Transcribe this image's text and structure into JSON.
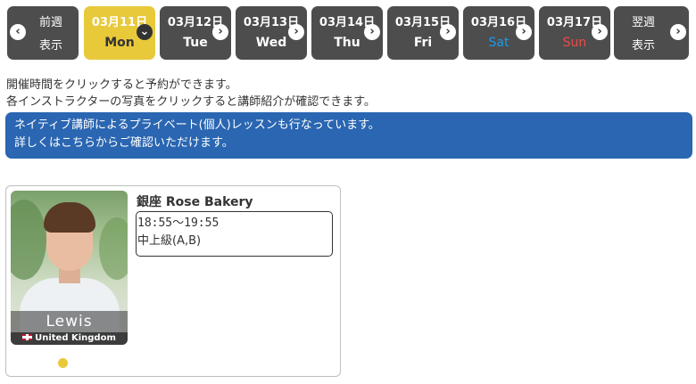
{
  "nav": {
    "prev": {
      "line1": "前週",
      "line2": "表示"
    },
    "next": {
      "line1": "翌週",
      "line2": "表示"
    },
    "days": [
      {
        "date": "03月11日",
        "weekday": "Mon"
      },
      {
        "date": "03月12日",
        "weekday": "Tue"
      },
      {
        "date": "03月13日",
        "weekday": "Wed"
      },
      {
        "date": "03月14日",
        "weekday": "Thu"
      },
      {
        "date": "03月15日",
        "weekday": "Fri"
      },
      {
        "date": "03月16日",
        "weekday": "Sat"
      },
      {
        "date": "03月17日",
        "weekday": "Sun"
      }
    ],
    "active_index": 0,
    "active_color": "#e8c93a",
    "sat_color": "#1e9be6",
    "sun_color": "#ee4a4a"
  },
  "info": {
    "line1": "開催時間をクリックすると予約ができます。",
    "line2": "各インストラクターの写真をクリックすると講師紹介が確認できます。"
  },
  "banner": {
    "line1": "ネイティブ講師によるプライベート(個人)レッスンも行なっています。",
    "line2": "詳しくはこちらからご確認いただけます。",
    "color": "#2a66b1"
  },
  "card": {
    "instructor_name": "Lewis",
    "country": "United Kingdom",
    "location": "銀座 Rose Bakery",
    "lesson": {
      "time": "18:55〜19:55",
      "level": "中上級(A,B)"
    },
    "dot_color": "#e8c93a"
  },
  "icons": {
    "prev": "chevron-left-icon",
    "next": "chevron-right-icon",
    "active": "chevron-down-icon"
  }
}
